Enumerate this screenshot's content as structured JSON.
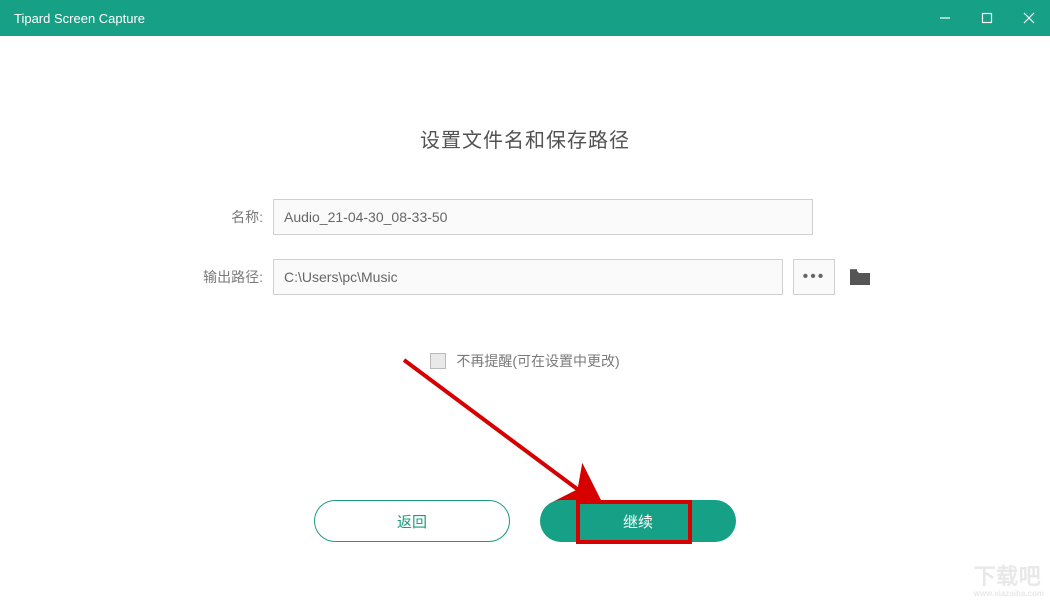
{
  "titlebar": {
    "title": "Tipard Screen Capture"
  },
  "dialog": {
    "heading": "设置文件名和保存路径",
    "name_label": "名称:",
    "name_value": "Audio_21-04-30_08-33-50",
    "path_label": "输出路径:",
    "path_value": "C:\\Users\\pc\\Music",
    "browse_dots": "•••",
    "checkbox_label": "不再提醒(可在设置中更改)",
    "back_label": "返回",
    "continue_label": "继续"
  },
  "watermark": {
    "main": "下载吧",
    "sub": "www.xiazaiba.com"
  }
}
